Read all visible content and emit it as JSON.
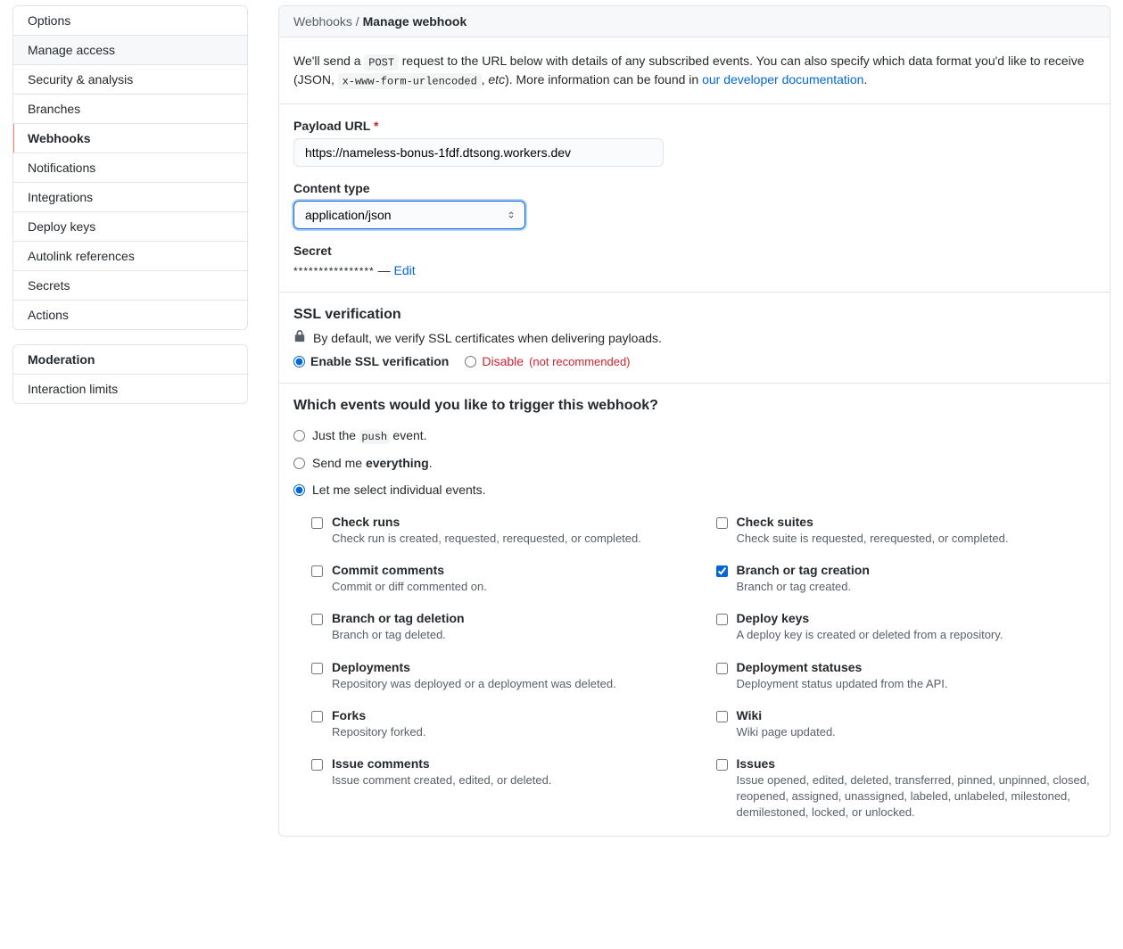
{
  "sidebar": {
    "groups": [
      {
        "items": [
          {
            "label": "Options",
            "selected": false,
            "highlighted": false
          },
          {
            "label": "Manage access",
            "selected": false,
            "highlighted": true
          },
          {
            "label": "Security & analysis",
            "selected": false,
            "highlighted": false
          },
          {
            "label": "Branches",
            "selected": false,
            "highlighted": false
          },
          {
            "label": "Webhooks",
            "selected": true,
            "highlighted": false
          },
          {
            "label": "Notifications",
            "selected": false,
            "highlighted": false
          },
          {
            "label": "Integrations",
            "selected": false,
            "highlighted": false
          },
          {
            "label": "Deploy keys",
            "selected": false,
            "highlighted": false
          },
          {
            "label": "Autolink references",
            "selected": false,
            "highlighted": false
          },
          {
            "label": "Secrets",
            "selected": false,
            "highlighted": false
          },
          {
            "label": "Actions",
            "selected": false,
            "highlighted": false
          }
        ]
      },
      {
        "heading": "Moderation",
        "items": [
          {
            "label": "Interaction limits",
            "selected": false,
            "highlighted": false
          }
        ]
      }
    ]
  },
  "header": {
    "crumb": "Webhooks / ",
    "current": "Manage webhook"
  },
  "intro": {
    "pre": "We'll send a ",
    "code1": "POST",
    "mid1": " request to the URL below with details of any subscribed events. You can also specify which data format you'd like to receive (JSON, ",
    "code2": "x-www-form-urlencoded",
    "mid2": ", ",
    "em": "etc",
    "mid3": "). More information can be found in ",
    "link": "our developer documentation",
    "post": "."
  },
  "payload": {
    "label": "Payload URL",
    "required_marker": "*",
    "value": "https://nameless-bonus-1fdf.dtsong.workers.dev"
  },
  "content_type": {
    "label": "Content type",
    "selected": "application/json"
  },
  "secret": {
    "label": "Secret",
    "masked": "****************",
    "dash": " — ",
    "edit": "Edit"
  },
  "ssl": {
    "heading": "SSL verification",
    "note": "By default, we verify SSL certificates when delivering payloads.",
    "enable": "Enable SSL verification",
    "disable": "Disable",
    "disable_note": "(not recommended)"
  },
  "events": {
    "heading": "Which events would you like to trigger this webhook?",
    "opt_push_pre": "Just the ",
    "opt_push_code": "push",
    "opt_push_post": " event.",
    "opt_everything_pre": "Send me ",
    "opt_everything_strong": "everything",
    "opt_everything_post": ".",
    "opt_individual": "Let me select individual events.",
    "list": [
      {
        "title": "Check runs",
        "desc": "Check run is created, requested, rerequested, or completed.",
        "checked": false
      },
      {
        "title": "Check suites",
        "desc": "Check suite is requested, rerequested, or completed.",
        "checked": false
      },
      {
        "title": "Commit comments",
        "desc": "Commit or diff commented on.",
        "checked": false
      },
      {
        "title": "Branch or tag creation",
        "desc": "Branch or tag created.",
        "checked": true
      },
      {
        "title": "Branch or tag deletion",
        "desc": "Branch or tag deleted.",
        "checked": false
      },
      {
        "title": "Deploy keys",
        "desc": "A deploy key is created or deleted from a repository.",
        "checked": false
      },
      {
        "title": "Deployments",
        "desc": "Repository was deployed or a deployment was deleted.",
        "checked": false
      },
      {
        "title": "Deployment statuses",
        "desc": "Deployment status updated from the API.",
        "checked": false
      },
      {
        "title": "Forks",
        "desc": "Repository forked.",
        "checked": false
      },
      {
        "title": "Wiki",
        "desc": "Wiki page updated.",
        "checked": false
      },
      {
        "title": "Issue comments",
        "desc": "Issue comment created, edited, or deleted.",
        "checked": false
      },
      {
        "title": "Issues",
        "desc": "Issue opened, edited, deleted, transferred, pinned, unpinned, closed, reopened, assigned, unassigned, labeled, unlabeled, milestoned, demilestoned, locked, or unlocked.",
        "checked": false
      }
    ]
  }
}
